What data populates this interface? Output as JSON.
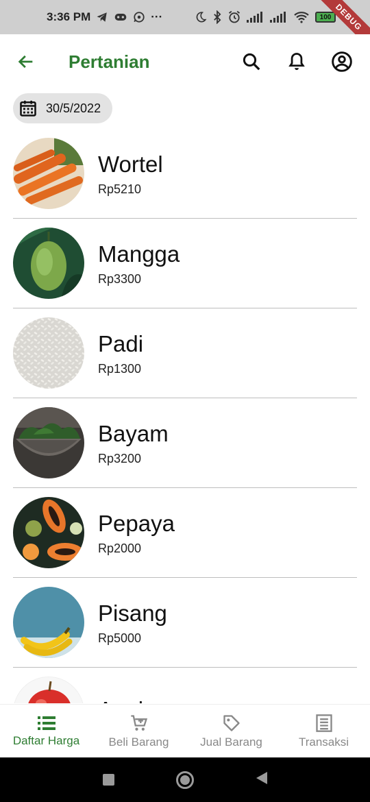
{
  "status_bar": {
    "time": "3:36 PM",
    "dots": "···",
    "battery": "100",
    "debug": "DEBUG"
  },
  "app_bar": {
    "title": "Pertanian"
  },
  "date_chip": {
    "date": "30/5/2022"
  },
  "products": [
    {
      "name": "Wortel",
      "price": "Rp5210"
    },
    {
      "name": "Mangga",
      "price": "Rp3300"
    },
    {
      "name": "Padi",
      "price": "Rp1300"
    },
    {
      "name": "Bayam",
      "price": "Rp3200"
    },
    {
      "name": "Pepaya",
      "price": "Rp2000"
    },
    {
      "name": "Pisang",
      "price": "Rp5000"
    },
    {
      "name": "Apel",
      "price": ""
    }
  ],
  "bottom_nav": {
    "items": [
      {
        "label": "Daftar Harga",
        "active": true
      },
      {
        "label": "Beli Barang",
        "active": false
      },
      {
        "label": "Jual Barang",
        "active": false
      },
      {
        "label": "Transaksi",
        "active": false
      }
    ]
  },
  "colors": {
    "accent": "#2e7d32",
    "inactive": "#888888",
    "chip_bg": "#e3e3e3",
    "divider": "#bdbdbd"
  }
}
